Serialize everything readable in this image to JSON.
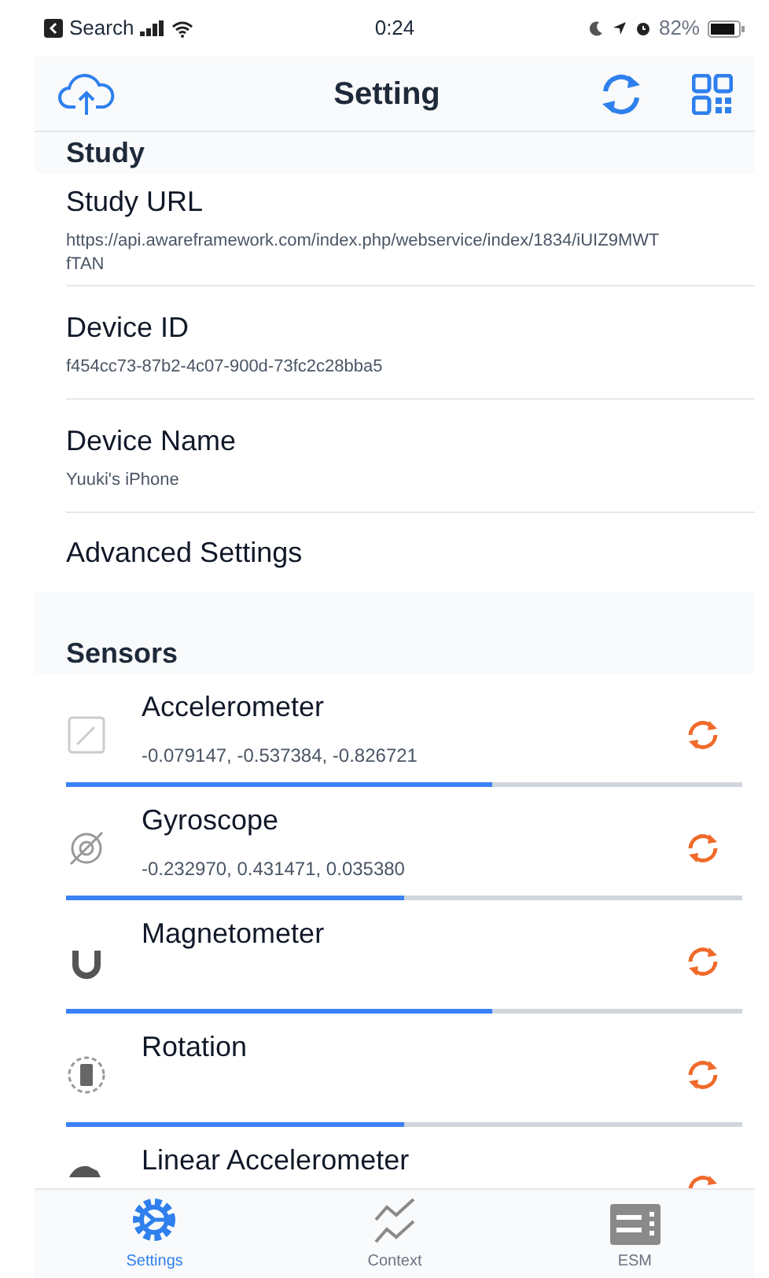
{
  "status_bar": {
    "back_label": "Search",
    "time": "0:24",
    "battery": "82%"
  },
  "nav": {
    "title": "Setting"
  },
  "sections": [
    {
      "title": "Study",
      "items": [
        {
          "label": "Study URL",
          "value": "https://api.awareframework.com/index.php/webservice/index/1834/iUIZ9MWTfTAN"
        },
        {
          "label": "Device ID",
          "value": "f454cc73-87b2-4c07-900d-73fc2c28bba5"
        },
        {
          "label": "Device Name",
          "value": "Yuuki's iPhone"
        },
        {
          "label": "Advanced Settings"
        }
      ]
    },
    {
      "title": "Sensors",
      "sensors": [
        {
          "kind": "accelerometer",
          "label": "Accelerometer",
          "value": "-0.079147, -0.537384, -0.826721",
          "level": 0.63
        },
        {
          "kind": "gyroscope",
          "label": "Gyroscope",
          "value": "-0.232970, 0.431471, 0.035380",
          "level": 0.5
        },
        {
          "kind": "magnetometer",
          "label": "Magnetometer",
          "level": 0.63
        },
        {
          "kind": "rotation",
          "label": "Rotation",
          "level": 0.5
        },
        {
          "kind": "linear",
          "label": "Linear Accelerometer"
        }
      ]
    }
  ],
  "tabs": [
    {
      "label": "Settings",
      "selected": true
    },
    {
      "label": "Context",
      "selected": false
    },
    {
      "label": "ESM",
      "selected": false
    }
  ]
}
